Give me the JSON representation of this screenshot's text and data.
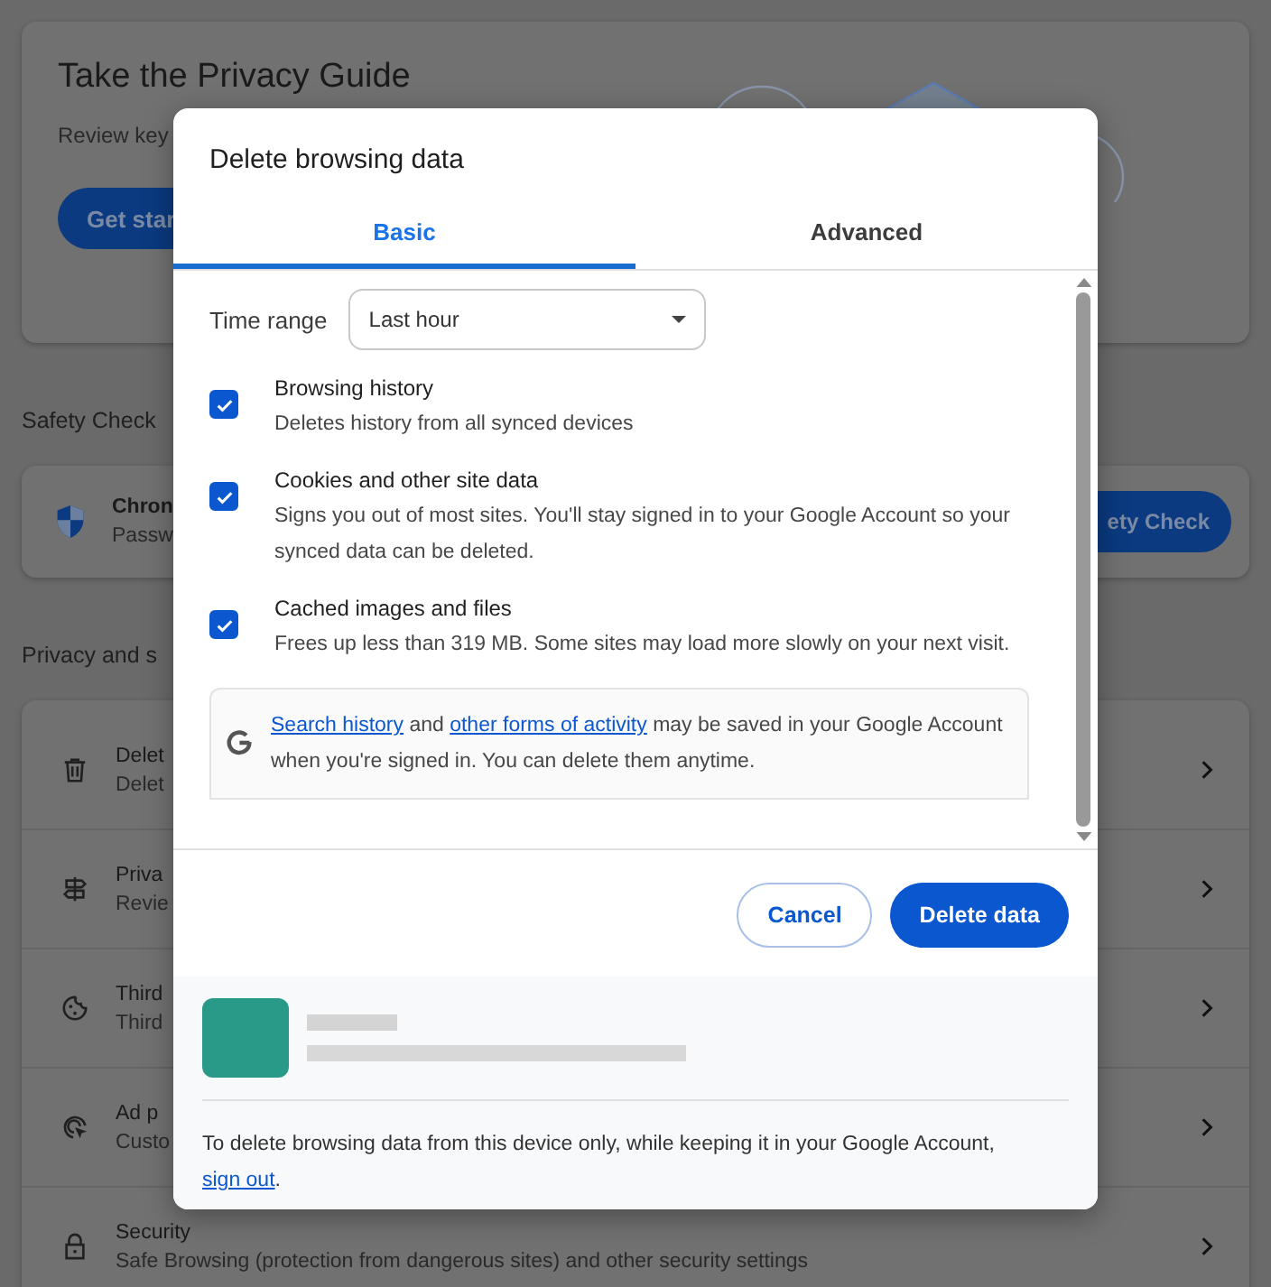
{
  "background": {
    "guide_card": {
      "title": "Take the Privacy Guide",
      "subtitle": "Review key",
      "button": "Get star"
    },
    "safety_heading": "Safety Check",
    "safety_card": {
      "title": "Chron",
      "subtitle": "Passw",
      "button": "ety Check"
    },
    "privacy_heading": "Privacy and s",
    "rows": [
      {
        "kind": "trash",
        "title": "Delet",
        "subtitle": "Delet"
      },
      {
        "kind": "signpost",
        "title": "Priva",
        "subtitle": "Revie"
      },
      {
        "kind": "cookie",
        "title": "Third",
        "subtitle": "Third"
      },
      {
        "kind": "target",
        "title": "Ad p",
        "subtitle": "Custo"
      },
      {
        "kind": "lock",
        "title": "Security",
        "subtitle": "Safe Browsing (protection from dangerous sites) and other security settings"
      }
    ]
  },
  "dialog": {
    "title": "Delete browsing data",
    "tabs": [
      {
        "label": "Basic",
        "selected": true
      },
      {
        "label": "Advanced",
        "selected": false
      }
    ],
    "time_range": {
      "label": "Time range",
      "value": "Last hour"
    },
    "options": [
      {
        "title": "Browsing history",
        "description": "Deletes history from all synced devices",
        "checked": true
      },
      {
        "title": "Cookies and other site data",
        "description": "Signs you out of most sites. You'll stay signed in to your Google Account so your synced data can be deleted.",
        "checked": true
      },
      {
        "title": "Cached images and files",
        "description": "Frees up less than 319 MB. Some sites may load more slowly on your next visit.",
        "checked": true
      }
    ],
    "note": [
      {
        "kind": "link",
        "text": "Search history"
      },
      {
        "kind": "text",
        "text": " and "
      },
      {
        "kind": "link",
        "text": "other forms of activity"
      },
      {
        "kind": "text",
        "text": " may be saved in your Google Account when you're signed in. You can delete them anytime."
      }
    ],
    "buttons": [
      {
        "kind": "secondary",
        "label": "Cancel"
      },
      {
        "kind": "primary",
        "label": "Delete data"
      }
    ],
    "notice": [
      {
        "kind": "text",
        "text": "To delete browsing data from this device only, while keeping it in your Google Account, "
      },
      {
        "kind": "link",
        "text": "sign out"
      },
      {
        "kind": "text",
        "text": "."
      }
    ]
  }
}
